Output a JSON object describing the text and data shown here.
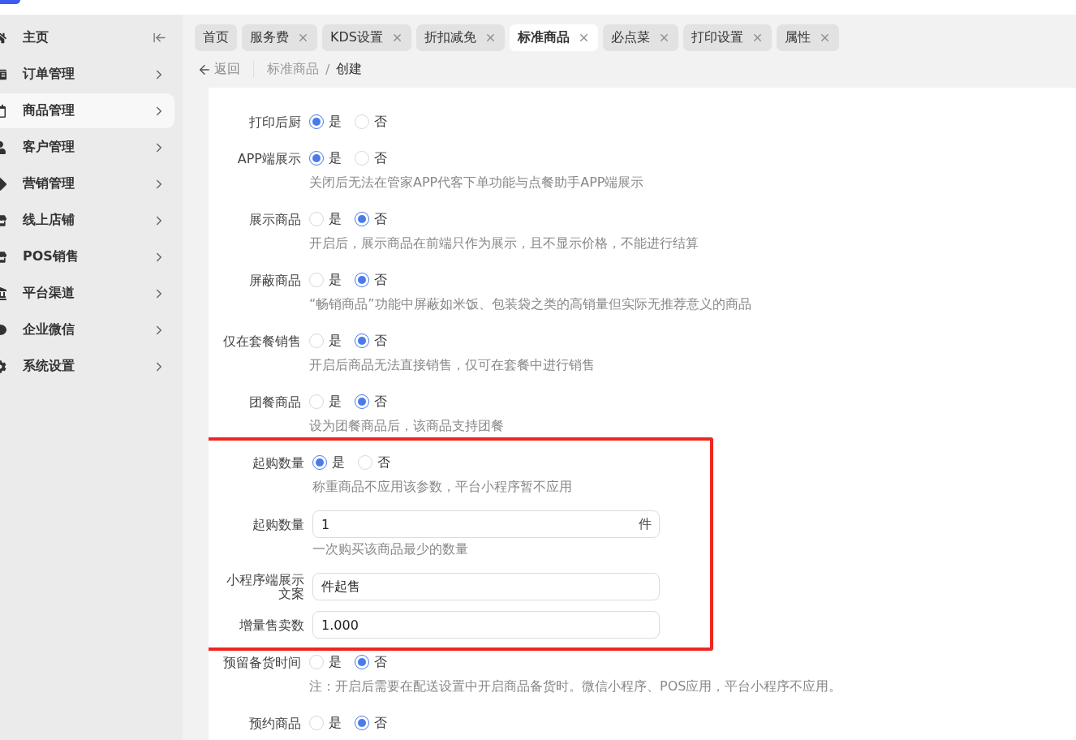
{
  "sidebar": {
    "items": [
      {
        "label": "主页",
        "selected": false
      },
      {
        "label": "订单管理",
        "selected": false
      },
      {
        "label": "商品管理",
        "selected": true
      },
      {
        "label": "客户管理",
        "selected": false
      },
      {
        "label": "营销管理",
        "selected": false
      },
      {
        "label": "线上店铺",
        "selected": false
      },
      {
        "label": "POS销售",
        "selected": false
      },
      {
        "label": "平台渠道",
        "selected": false
      },
      {
        "label": "企业微信",
        "selected": false
      },
      {
        "label": "系统设置",
        "selected": false
      }
    ]
  },
  "tabs": [
    {
      "label": "首页",
      "selected": false,
      "closable": false
    },
    {
      "label": "服务费",
      "selected": false,
      "closable": true
    },
    {
      "label": "KDS设置",
      "selected": false,
      "closable": true
    },
    {
      "label": "折扣减免",
      "selected": false,
      "closable": true
    },
    {
      "label": "标准商品",
      "selected": true,
      "closable": true
    },
    {
      "label": "必点菜",
      "selected": false,
      "closable": true
    },
    {
      "label": "打印设置",
      "selected": false,
      "closable": true
    },
    {
      "label": "属性",
      "selected": false,
      "closable": true
    }
  ],
  "breadcrumb": {
    "back": "返回",
    "parent": "标准商品",
    "separator": "/",
    "current": "创建"
  },
  "groups": [
    {
      "highlighted": false,
      "fields": [
        {
          "kind": "radio",
          "label": "打印后厨",
          "options": [
            {
              "label": "是",
              "selected": true
            },
            {
              "label": "否",
              "selected": false
            }
          ]
        },
        {
          "kind": "radio",
          "label": "APP端展示",
          "options": [
            {
              "label": "是",
              "selected": true
            },
            {
              "label": "否",
              "selected": false
            }
          ],
          "hint": "关闭后无法在管家APP代客下单功能与点餐助手APP端展示"
        },
        {
          "kind": "radio",
          "label": "展示商品",
          "options": [
            {
              "label": "是",
              "selected": false
            },
            {
              "label": "否",
              "selected": true
            }
          ],
          "hint": "开启后，展示商品在前端只作为展示，且不显示价格，不能进行结算"
        },
        {
          "kind": "radio",
          "label": "屏蔽商品",
          "options": [
            {
              "label": "是",
              "selected": false
            },
            {
              "label": "否",
              "selected": true
            }
          ],
          "hint": "“畅销商品”功能中屏蔽如米饭、包装袋之类的高销量但实际无推荐意义的商品"
        },
        {
          "kind": "radio",
          "label": "仅在套餐销售",
          "options": [
            {
              "label": "是",
              "selected": false
            },
            {
              "label": "否",
              "selected": true
            }
          ],
          "hint": "开启后商品无法直接销售，仅可在套餐中进行销售"
        },
        {
          "kind": "radio",
          "label": "团餐商品",
          "options": [
            {
              "label": "是",
              "selected": false
            },
            {
              "label": "否",
              "selected": true
            }
          ],
          "hint": "设为团餐商品后，该商品支持团餐"
        }
      ]
    },
    {
      "highlighted": true,
      "fields": [
        {
          "kind": "radio",
          "label": "起购数量",
          "options": [
            {
              "label": "是",
              "selected": true
            },
            {
              "label": "否",
              "selected": false
            }
          ],
          "hint": "称重商品不应用该参数，平台小程序暂不应用"
        },
        {
          "kind": "input",
          "label": "起购数量",
          "value": "1",
          "suffix": "件",
          "hint": "一次购买该商品最少的数量"
        },
        {
          "kind": "input",
          "label": "小程序端展示文案",
          "value": "件起售"
        },
        {
          "kind": "input",
          "label": "增量售卖数",
          "value": "1.000"
        }
      ]
    },
    {
      "highlighted": false,
      "fields": [
        {
          "kind": "radio",
          "label": "预留备货时间",
          "options": [
            {
              "label": "是",
              "selected": false
            },
            {
              "label": "否",
              "selected": true
            }
          ],
          "hint": "注：开启后需要在配送设置中开启商品备货时。微信小程序、POS应用，平台小程序不应用。"
        },
        {
          "kind": "radio",
          "label": "预约商品",
          "options": [
            {
              "label": "是",
              "selected": false
            },
            {
              "label": "否",
              "selected": true
            }
          ]
        }
      ]
    }
  ]
}
